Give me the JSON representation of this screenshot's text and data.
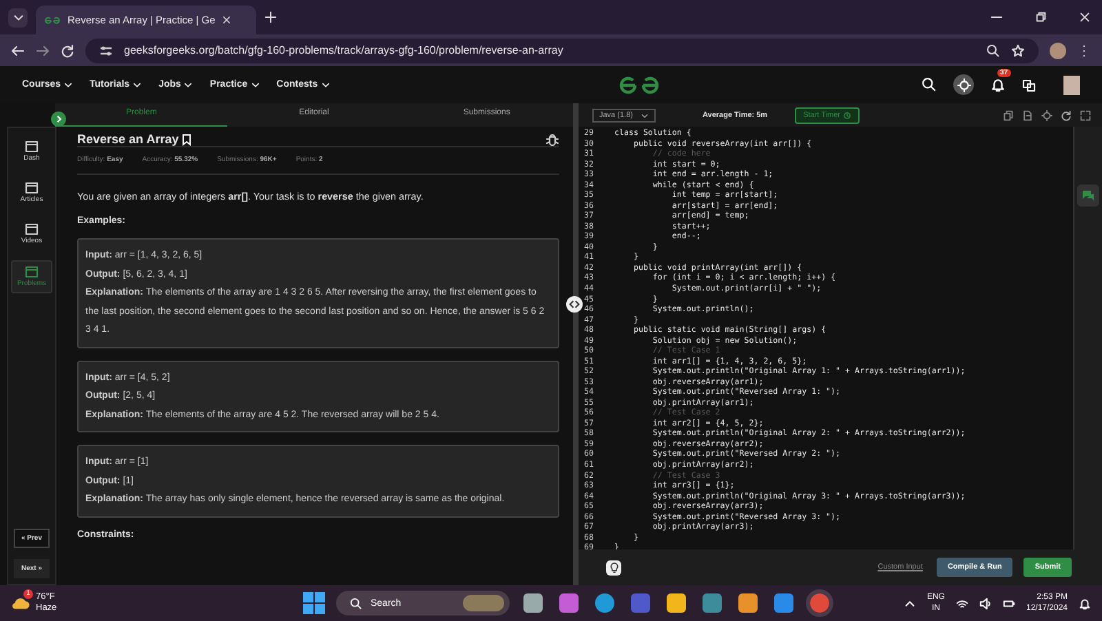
{
  "browser": {
    "tab_title": "Reverse an Array | Practice | Ge",
    "url": "geeksforgeeks.org/batch/gfg-160-problems/track/arrays-gfg-160/problem/reverse-an-array"
  },
  "site_nav": {
    "items": [
      "Courses",
      "Tutorials",
      "Jobs",
      "Practice",
      "Contests"
    ],
    "notification_count": "37"
  },
  "sidebar": {
    "items": [
      {
        "label": "Dash",
        "selected": false
      },
      {
        "label": "Articles",
        "selected": false
      },
      {
        "label": "Videos",
        "selected": false
      },
      {
        "label": "Problems",
        "selected": true
      }
    ],
    "prev": "« Prev",
    "next": "Next »"
  },
  "problem_tabs": [
    {
      "label": "Problem",
      "selected": true
    },
    {
      "label": "Editorial",
      "selected": false
    },
    {
      "label": "Submissions",
      "selected": false
    }
  ],
  "problem": {
    "title": "Reverse an Array",
    "meta": [
      {
        "label": "Difficulty:",
        "value": "Easy"
      },
      {
        "label": "Accuracy:",
        "value": "55.32%"
      },
      {
        "label": "Submissions:",
        "value": "96K+"
      },
      {
        "label": "Points:",
        "value": "2"
      }
    ],
    "description": "You are given an array of integers **arr[]**. Your task is to **reverse** the given array.",
    "examples_heading": "Examples:",
    "examples": [
      {
        "input": "**Input:** arr = [1, 4, 3, 2, 6, 5]",
        "output": "**Output:** [5, 6, 2, 3, 4, 1]",
        "explanation": "**Explanation:** The elements of the array are 1 4 3 2 6 5. After reversing the array, the first element goes to the last position, the second element goes to the second last position and so on. Hence, the answer is 5 6 2 3 4 1."
      },
      {
        "input": "**Input:** arr = [4, 5, 2]",
        "output": "**Output:** [2, 5, 4]",
        "explanation": "**Explanation:** The elements of the array are 4 5 2. The reversed array will be 2 5 4."
      },
      {
        "input": "**Input:** arr = [1]",
        "output": "**Output:** [1]",
        "explanation": "**Explanation:** The array has only single element, hence the reversed array is same as the original."
      }
    ],
    "constraints_heading": "Constraints:"
  },
  "editor": {
    "language": "Java (1.8)",
    "average_time": "Average Time: 5m",
    "start_timer": "Start Timer",
    "lines": [
      {
        "number": "29",
        "kind": "code",
        "text": "class Solution {"
      },
      {
        "number": "30",
        "kind": "code",
        "text": "    public void reverseArray(int arr[]) {"
      },
      {
        "number": "31",
        "kind": "comment",
        "text": "        // code here"
      },
      {
        "number": "32",
        "kind": "code",
        "text": "        int start = 0;"
      },
      {
        "number": "33",
        "kind": "code",
        "text": "        int end = arr.length - 1;"
      },
      {
        "number": "34",
        "kind": "code",
        "text": "        while (start < end) {"
      },
      {
        "number": "35",
        "kind": "code",
        "text": "            int temp = arr[start];"
      },
      {
        "number": "36",
        "kind": "code",
        "text": "            arr[start] = arr[end];"
      },
      {
        "number": "37",
        "kind": "code",
        "text": "            arr[end] = temp;"
      },
      {
        "number": "38",
        "kind": "code",
        "text": "            start++;"
      },
      {
        "number": "39",
        "kind": "code",
        "text": "            end--;"
      },
      {
        "number": "40",
        "kind": "code",
        "text": "        }"
      },
      {
        "number": "41",
        "kind": "code",
        "text": "    }"
      },
      {
        "number": "42",
        "kind": "code",
        "text": "    public void printArray(int arr[]) {"
      },
      {
        "number": "43",
        "kind": "code",
        "text": "        for (int i = 0; i < arr.length; i++) {"
      },
      {
        "number": "44",
        "kind": "code",
        "text": "            System.out.print(arr[i] + \" \");"
      },
      {
        "number": "45",
        "kind": "code",
        "text": "        }"
      },
      {
        "number": "46",
        "kind": "code",
        "text": "        System.out.println();"
      },
      {
        "number": "47",
        "kind": "code",
        "text": "    }"
      },
      {
        "number": "48",
        "kind": "code",
        "text": "    public static void main(String[] args) {"
      },
      {
        "number": "49",
        "kind": "code",
        "text": "        Solution obj = new Solution();"
      },
      {
        "number": "50",
        "kind": "comment",
        "text": "        // Test Case 1"
      },
      {
        "number": "51",
        "kind": "code",
        "text": "        int arr1[] = {1, 4, 3, 2, 6, 5};"
      },
      {
        "number": "52",
        "kind": "code",
        "text": "        System.out.println(\"Original Array 1: \" + Arrays.toString(arr1));"
      },
      {
        "number": "53",
        "kind": "code",
        "text": "        obj.reverseArray(arr1);"
      },
      {
        "number": "54",
        "kind": "code",
        "text": "        System.out.print(\"Reversed Array 1: \");"
      },
      {
        "number": "55",
        "kind": "code",
        "text": "        obj.printArray(arr1);"
      },
      {
        "number": "56",
        "kind": "comment",
        "text": "        // Test Case 2"
      },
      {
        "number": "57",
        "kind": "code",
        "text": "        int arr2[] = {4, 5, 2};"
      },
      {
        "number": "58",
        "kind": "code",
        "text": "        System.out.println(\"Original Array 2: \" + Arrays.toString(arr2));"
      },
      {
        "number": "59",
        "kind": "code",
        "text": "        obj.reverseArray(arr2);"
      },
      {
        "number": "60",
        "kind": "code",
        "text": "        System.out.print(\"Reversed Array 2: \");"
      },
      {
        "number": "61",
        "kind": "code",
        "text": "        obj.printArray(arr2);"
      },
      {
        "number": "62",
        "kind": "comment",
        "text": "        // Test Case 3"
      },
      {
        "number": "63",
        "kind": "code",
        "text": "        int arr3[] = {1};"
      },
      {
        "number": "64",
        "kind": "code",
        "text": "        System.out.println(\"Original Array 3: \" + Arrays.toString(arr3));"
      },
      {
        "number": "65",
        "kind": "code",
        "text": "        obj.reverseArray(arr3);"
      },
      {
        "number": "66",
        "kind": "code",
        "text": "        System.out.print(\"Reversed Array 3: \");"
      },
      {
        "number": "67",
        "kind": "code",
        "text": "        obj.printArray(arr3);"
      },
      {
        "number": "68",
        "kind": "code",
        "text": "    }"
      },
      {
        "number": "69",
        "kind": "code",
        "text": "}"
      }
    ],
    "custom_input": "Custom Input",
    "compile_run": "Compile & Run",
    "submit": "Submit"
  },
  "taskbar": {
    "temperature": "76°F",
    "weather": "Haze",
    "weather_badge": "1",
    "search": "Search",
    "language": "ENG",
    "region": "IN",
    "time": "2:53 PM",
    "date": "12/17/2024"
  }
}
